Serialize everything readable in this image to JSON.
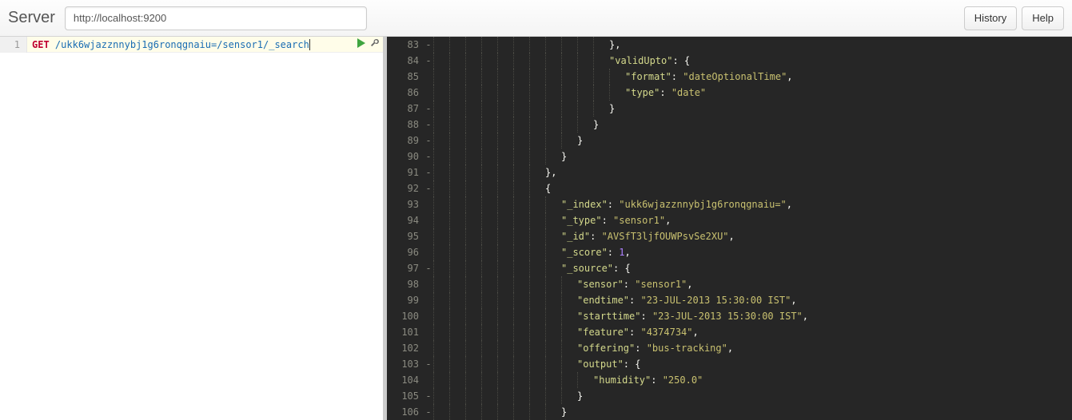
{
  "toolbar": {
    "server_label": "Server",
    "server_value": "http://localhost:9200",
    "history_label": "History",
    "help_label": "Help"
  },
  "request": {
    "line_number": "1",
    "method": "GET",
    "path": "/ukk6wjazznnybj1g6ronqgnaiu=/sensor1/_search"
  },
  "response_lines": [
    {
      "n": 83,
      "fold": "-",
      "indent": 11,
      "tokens": [
        {
          "t": "punc",
          "v": "},"
        }
      ]
    },
    {
      "n": 84,
      "fold": "-",
      "indent": 11,
      "tokens": [
        {
          "t": "key",
          "v": "\"validUpto\""
        },
        {
          "t": "punc",
          "v": ": {"
        }
      ]
    },
    {
      "n": 85,
      "fold": "",
      "indent": 12,
      "tokens": [
        {
          "t": "key",
          "v": "\"format\""
        },
        {
          "t": "punc",
          "v": ": "
        },
        {
          "t": "str",
          "v": "\"dateOptionalTime\""
        },
        {
          "t": "punc",
          "v": ","
        }
      ]
    },
    {
      "n": 86,
      "fold": "",
      "indent": 12,
      "tokens": [
        {
          "t": "key",
          "v": "\"type\""
        },
        {
          "t": "punc",
          "v": ": "
        },
        {
          "t": "str",
          "v": "\"date\""
        }
      ]
    },
    {
      "n": 87,
      "fold": "-",
      "indent": 11,
      "tokens": [
        {
          "t": "punc",
          "v": "}"
        }
      ]
    },
    {
      "n": 88,
      "fold": "-",
      "indent": 10,
      "tokens": [
        {
          "t": "punc",
          "v": "}"
        }
      ]
    },
    {
      "n": 89,
      "fold": "-",
      "indent": 9,
      "tokens": [
        {
          "t": "punc",
          "v": "}"
        }
      ]
    },
    {
      "n": 90,
      "fold": "-",
      "indent": 8,
      "tokens": [
        {
          "t": "punc",
          "v": "}"
        }
      ]
    },
    {
      "n": 91,
      "fold": "-",
      "indent": 7,
      "tokens": [
        {
          "t": "punc",
          "v": "},"
        }
      ]
    },
    {
      "n": 92,
      "fold": "-",
      "indent": 7,
      "tokens": [
        {
          "t": "punc",
          "v": "{"
        }
      ]
    },
    {
      "n": 93,
      "fold": "",
      "indent": 8,
      "tokens": [
        {
          "t": "key",
          "v": "\"_index\""
        },
        {
          "t": "punc",
          "v": ": "
        },
        {
          "t": "str",
          "v": "\"ukk6wjazznnybj1g6ronqgnaiu=\""
        },
        {
          "t": "punc",
          "v": ","
        }
      ]
    },
    {
      "n": 94,
      "fold": "",
      "indent": 8,
      "tokens": [
        {
          "t": "key",
          "v": "\"_type\""
        },
        {
          "t": "punc",
          "v": ": "
        },
        {
          "t": "str",
          "v": "\"sensor1\""
        },
        {
          "t": "punc",
          "v": ","
        }
      ]
    },
    {
      "n": 95,
      "fold": "",
      "indent": 8,
      "tokens": [
        {
          "t": "key",
          "v": "\"_id\""
        },
        {
          "t": "punc",
          "v": ": "
        },
        {
          "t": "str",
          "v": "\"AVSfT3ljfOUWPsvSe2XU\""
        },
        {
          "t": "punc",
          "v": ","
        }
      ]
    },
    {
      "n": 96,
      "fold": "",
      "indent": 8,
      "tokens": [
        {
          "t": "key",
          "v": "\"_score\""
        },
        {
          "t": "punc",
          "v": ": "
        },
        {
          "t": "num",
          "v": "1"
        },
        {
          "t": "punc",
          "v": ","
        }
      ]
    },
    {
      "n": 97,
      "fold": "-",
      "indent": 8,
      "tokens": [
        {
          "t": "key",
          "v": "\"_source\""
        },
        {
          "t": "punc",
          "v": ": {"
        }
      ]
    },
    {
      "n": 98,
      "fold": "",
      "indent": 9,
      "tokens": [
        {
          "t": "key",
          "v": "\"sensor\""
        },
        {
          "t": "punc",
          "v": ": "
        },
        {
          "t": "str",
          "v": "\"sensor1\""
        },
        {
          "t": "punc",
          "v": ","
        }
      ]
    },
    {
      "n": 99,
      "fold": "",
      "indent": 9,
      "tokens": [
        {
          "t": "key",
          "v": "\"endtime\""
        },
        {
          "t": "punc",
          "v": ": "
        },
        {
          "t": "str",
          "v": "\"23-JUL-2013 15:30:00 IST\""
        },
        {
          "t": "punc",
          "v": ","
        }
      ]
    },
    {
      "n": 100,
      "fold": "",
      "indent": 9,
      "tokens": [
        {
          "t": "key",
          "v": "\"starttime\""
        },
        {
          "t": "punc",
          "v": ": "
        },
        {
          "t": "str",
          "v": "\"23-JUL-2013 15:30:00 IST\""
        },
        {
          "t": "punc",
          "v": ","
        }
      ]
    },
    {
      "n": 101,
      "fold": "",
      "indent": 9,
      "tokens": [
        {
          "t": "key",
          "v": "\"feature\""
        },
        {
          "t": "punc",
          "v": ": "
        },
        {
          "t": "str",
          "v": "\"4374734\""
        },
        {
          "t": "punc",
          "v": ","
        }
      ]
    },
    {
      "n": 102,
      "fold": "",
      "indent": 9,
      "tokens": [
        {
          "t": "key",
          "v": "\"offering\""
        },
        {
          "t": "punc",
          "v": ": "
        },
        {
          "t": "str",
          "v": "\"bus-tracking\""
        },
        {
          "t": "punc",
          "v": ","
        }
      ]
    },
    {
      "n": 103,
      "fold": "-",
      "indent": 9,
      "tokens": [
        {
          "t": "key",
          "v": "\"output\""
        },
        {
          "t": "punc",
          "v": ": {"
        }
      ]
    },
    {
      "n": 104,
      "fold": "",
      "indent": 10,
      "tokens": [
        {
          "t": "key",
          "v": "\"humidity\""
        },
        {
          "t": "punc",
          "v": ": "
        },
        {
          "t": "str",
          "v": "\"250.0\""
        }
      ]
    },
    {
      "n": 105,
      "fold": "-",
      "indent": 9,
      "tokens": [
        {
          "t": "punc",
          "v": "}"
        }
      ]
    },
    {
      "n": 106,
      "fold": "-",
      "indent": 8,
      "tokens": [
        {
          "t": "punc",
          "v": "}"
        }
      ]
    }
  ]
}
